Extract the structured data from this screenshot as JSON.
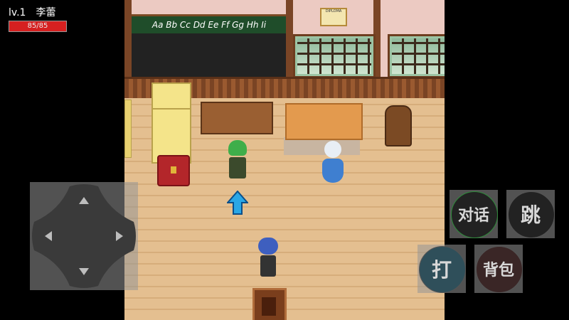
{
  "hud": {
    "level": "lv.1",
    "name": "李蕾",
    "hp_text": "85/85",
    "hp_fraction": 1.0
  },
  "scene": {
    "chalkboard_text": "Aa Bb Cc Dd Ee Ff Gg Hh Ii",
    "diploma_text": "DIPLOMA"
  },
  "controls": {
    "talk_label": "对话",
    "jump_label": "跳",
    "attack_label": "打",
    "bag_label": "背包"
  },
  "colors": {
    "hp": "#d62020",
    "quest_arrow": "#2aa7e6"
  }
}
